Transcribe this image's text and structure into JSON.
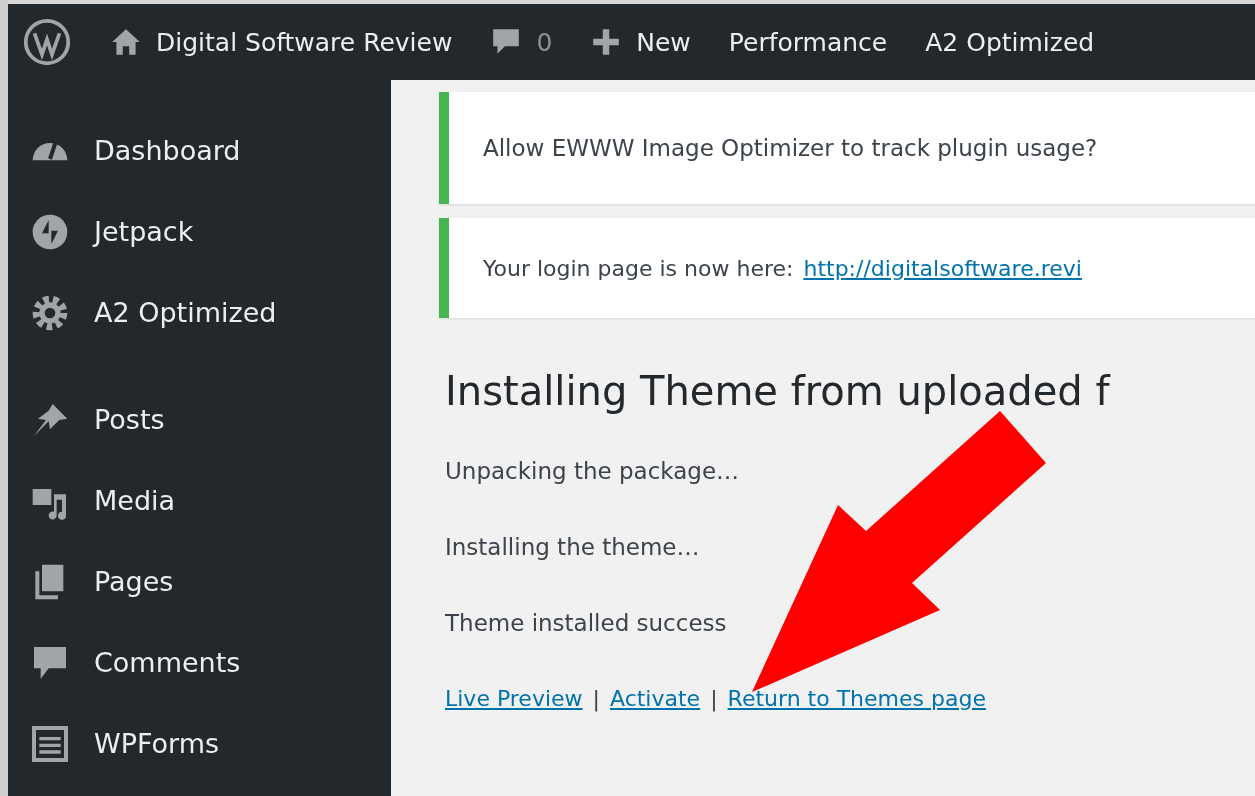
{
  "admin_bar": {
    "site_name": "Digital Software Review",
    "comments_count": "0",
    "new_label": "New",
    "menu_items": [
      "Performance",
      "A2 Optimized"
    ]
  },
  "sidebar": {
    "sections": [
      {
        "items": [
          {
            "label": "Dashboard"
          },
          {
            "label": "Jetpack"
          },
          {
            "label": "A2 Optimized"
          }
        ]
      },
      {
        "items": [
          {
            "label": "Posts"
          },
          {
            "label": "Media"
          },
          {
            "label": "Pages"
          },
          {
            "label": "Comments"
          },
          {
            "label": "WPForms"
          }
        ]
      }
    ]
  },
  "notices": [
    {
      "text": "Allow EWWW Image Optimizer to track plugin usage?"
    },
    {
      "text": "Your login page is now here:",
      "link": "http://digitalsoftware.revi"
    }
  ],
  "heading": "Installing Theme from uploaded f",
  "messages": [
    "Unpacking the package…",
    "Installing the theme…",
    "Theme installed success"
  ],
  "actions": [
    {
      "kind": "link",
      "text": "Live Preview"
    },
    {
      "kind": "separator",
      "text": "|"
    },
    {
      "kind": "link",
      "text": "Activate"
    },
    {
      "kind": "separator",
      "text": "|"
    },
    {
      "kind": "link",
      "text": "Return to Themes page"
    }
  ]
}
